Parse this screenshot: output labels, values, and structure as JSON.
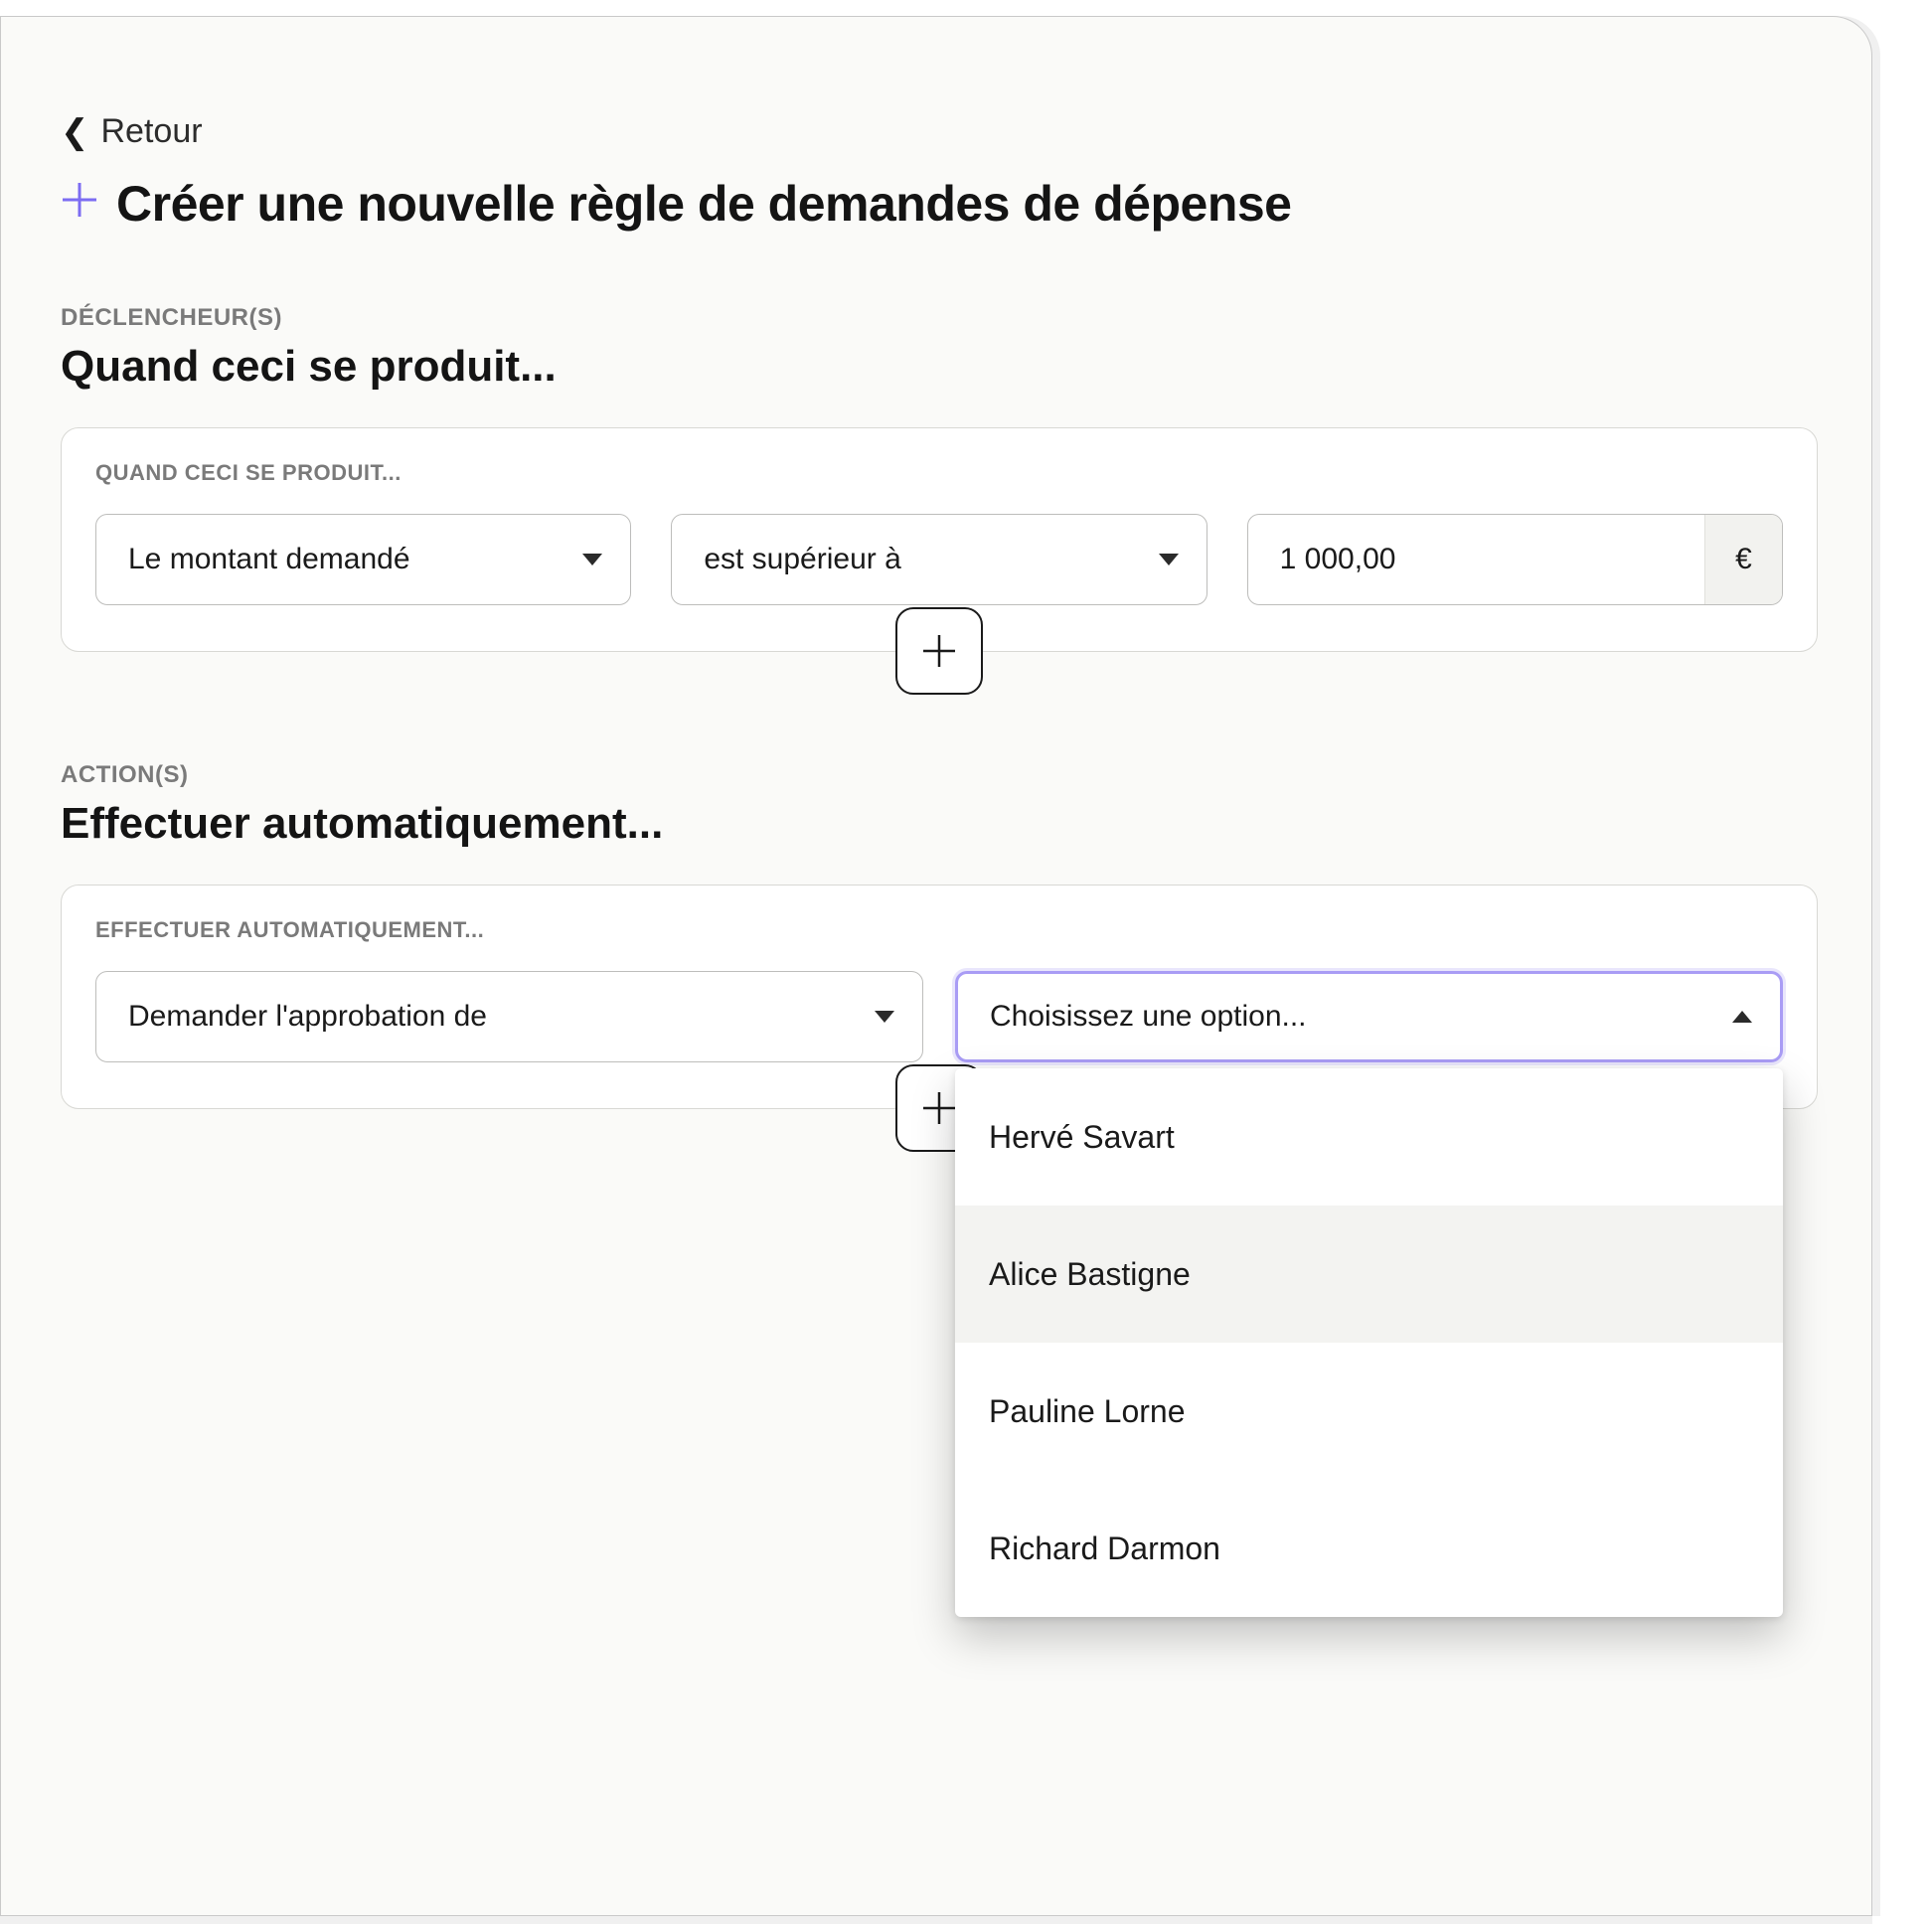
{
  "back": {
    "label": "Retour"
  },
  "title": "Créer une nouvelle règle de demandes de dépense",
  "trigger": {
    "eyebrow": "DÉCLENCHEUR(S)",
    "heading": "Quand ceci se produit...",
    "card_eyebrow": "QUAND CECI SE PRODUIT...",
    "field": "Le montant demandé",
    "operator": "est supérieur à",
    "amount": "1 000,00",
    "currency": "€"
  },
  "action": {
    "eyebrow": "ACTION(S)",
    "heading": "Effectuer automatiquement...",
    "card_eyebrow": "EFFECTUER AUTOMATIQUEMENT...",
    "action_select": "Demander l'approbation de",
    "option_placeholder": "Choisissez une option...",
    "options": [
      "Hervé Savart",
      "Alice Bastigne",
      "Pauline Lorne",
      "Richard Darmon"
    ]
  }
}
